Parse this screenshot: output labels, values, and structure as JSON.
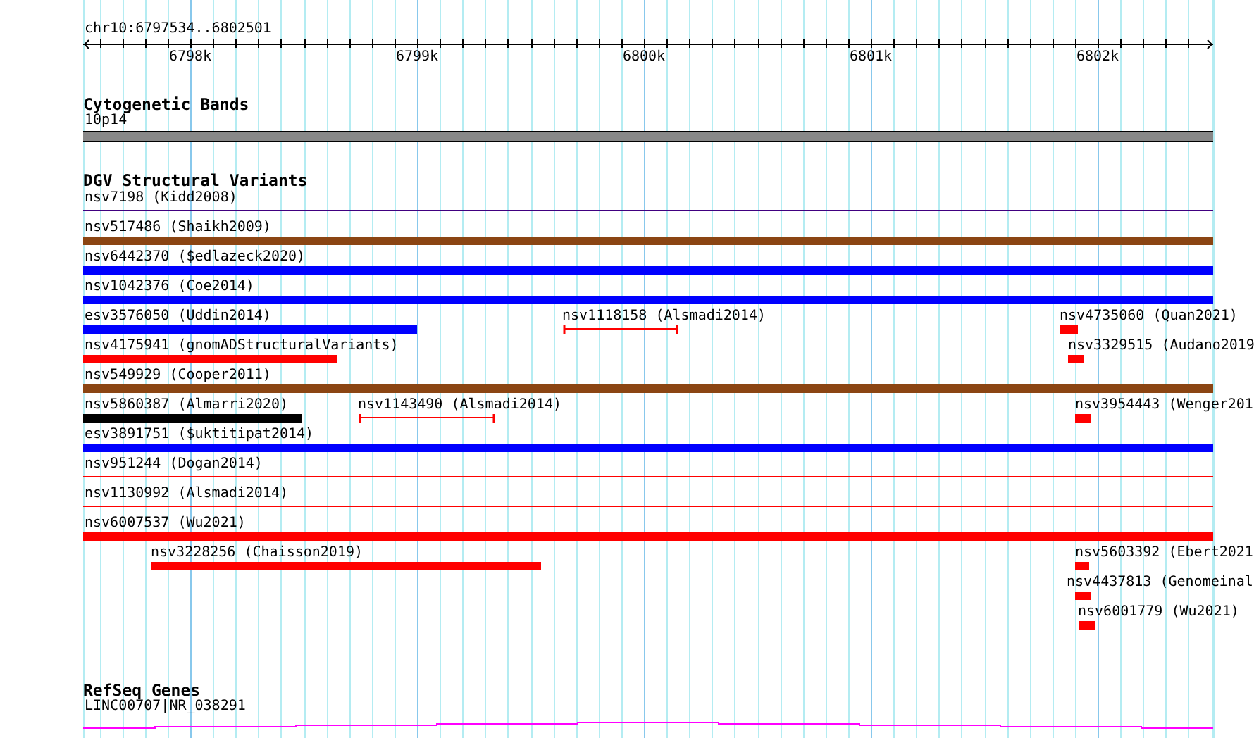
{
  "ruler": {
    "position": "chr10:6797534..6802501",
    "ticks": [
      "6798k",
      "6799k",
      "6800k",
      "6801k",
      "6802k"
    ]
  },
  "cytogenetic_bands": {
    "title": "Cytogenetic Bands",
    "band": "10p14"
  },
  "dgv_structural_variants": {
    "title": "DGV Structural Variants",
    "rows": [
      {
        "features": [
          {
            "label": "nsv7198 (Kidd2008)",
            "kind": "line",
            "color": "#400080"
          }
        ]
      },
      {
        "features": [
          {
            "label": "nsv517486 (Shaikh2009)",
            "kind": "bar",
            "color": "#8b4513"
          }
        ]
      },
      {
        "features": [
          {
            "label": "nsv6442370 ($edlazeck2020)",
            "kind": "bar",
            "color": "#0000ff"
          }
        ]
      },
      {
        "features": [
          {
            "label": "nsv1042376 (Coe2014)",
            "kind": "bar",
            "color": "#0000ff"
          }
        ]
      },
      {
        "features": [
          {
            "label": "esv3576050 (Uddin2014)",
            "kind": "bar",
            "color": "#0000ff"
          },
          {
            "label": "nsv1118158 (Alsmadi2014)",
            "kind": "interval",
            "color": "#ff0000"
          },
          {
            "label": "nsv4735060 (Quan2021)",
            "kind": "bar",
            "color": "#ff0000"
          }
        ]
      },
      {
        "features": [
          {
            "label": "nsv4175941 (gnomADStructuralVariants)",
            "kind": "bar",
            "color": "#ff0000"
          },
          {
            "label": "nsv3329515 (Audano2019",
            "kind": "bar",
            "color": "#ff0000"
          }
        ]
      },
      {
        "features": [
          {
            "label": "nsv549929 (Cooper2011)",
            "kind": "bar",
            "color": "#8b4513"
          }
        ]
      },
      {
        "features": [
          {
            "label": "nsv5860387 (Almarri2020)",
            "kind": "bar",
            "color": "#000000"
          },
          {
            "label": "nsv1143490 (Alsmadi2014)",
            "kind": "interval",
            "color": "#ff0000"
          },
          {
            "label": "nsv3954443 (Wenger201",
            "kind": "bar",
            "color": "#ff0000"
          }
        ]
      },
      {
        "features": [
          {
            "label": "esv3891751 ($uktitipat2014)",
            "kind": "bar",
            "color": "#0000ff"
          }
        ]
      },
      {
        "features": [
          {
            "label": "nsv951244 (Dogan2014)",
            "kind": "line",
            "color": "#ff0000"
          }
        ]
      },
      {
        "features": [
          {
            "label": "nsv1130992 (Alsmadi2014)",
            "kind": "line",
            "color": "#ff0000"
          }
        ]
      },
      {
        "features": [
          {
            "label": "nsv6007537 (Wu2021)",
            "kind": "bar",
            "color": "#ff0000"
          }
        ]
      },
      {
        "features": [
          {
            "label": "nsv3228256 (Chaisson2019)",
            "kind": "bar",
            "color": "#ff0000"
          },
          {
            "label": "nsv5603392 (Ebert2021",
            "kind": "bar",
            "color": "#ff0000"
          }
        ]
      },
      {
        "features": [
          {
            "label": "nsv4437813 (Genomeinal",
            "kind": "bar",
            "color": "#ff0000"
          }
        ]
      },
      {
        "features": [
          {
            "label": "nsv6001779 (Wu2021)",
            "kind": "bar",
            "color": "#ff0000"
          }
        ]
      }
    ]
  },
  "refseq_genes": {
    "title": "RefSeq Genes",
    "gene": "LINC00707|NR_038291"
  }
}
